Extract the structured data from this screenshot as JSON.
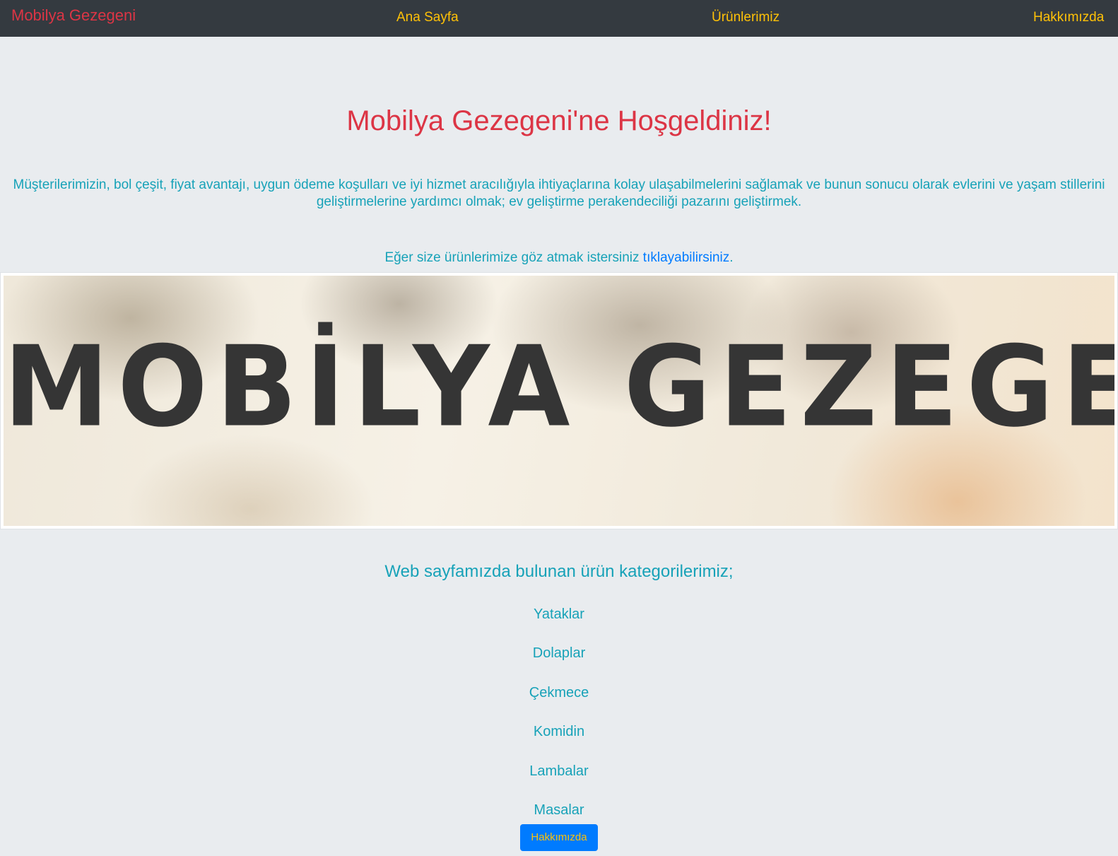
{
  "navbar": {
    "brand": "Mobilya Gezegeni",
    "links": [
      "Ana Sayfa",
      "Ürünlerimiz",
      "Hakkımızda"
    ],
    "background_color": "#343a40",
    "brand_color": "#dc3545",
    "link_color": "#ffc107"
  },
  "hero": {
    "title": "Mobilya Gezegeni'ne Hoşgeldiniz!",
    "mission": "Müşterilerimizin, bol çeşit, fiyat avantajı, uygun ödeme koşulları ve iyi hizmet aracılığıyla ihtiyaçlarına kolay ulaşabilmelerini sağlamak ve bunun sonucu olarak evlerini ve yaşam stillerini geliştirmelerine yardımcı olmak; ev geliştirme perakendeciliği pazarını geliştirmek.",
    "invite_prefix": "Eğer size ürünlerimize göz atmak istersiniz ",
    "invite_link": "tıklayabilirsiniz",
    "invite_suffix": "."
  },
  "banner": {
    "text": "MOBİLYA GEZEGENİ"
  },
  "categories": {
    "title": "Web sayfamızda bulunan ürün kategorilerimiz;",
    "items": [
      "Yataklar",
      "Dolaplar",
      "Çekmece",
      "Komidin",
      "Lambalar",
      "Masalar"
    ]
  },
  "footer_button": {
    "label": "Hakkımızda",
    "background_color": "#007bff",
    "text_color": "#ffc107"
  }
}
